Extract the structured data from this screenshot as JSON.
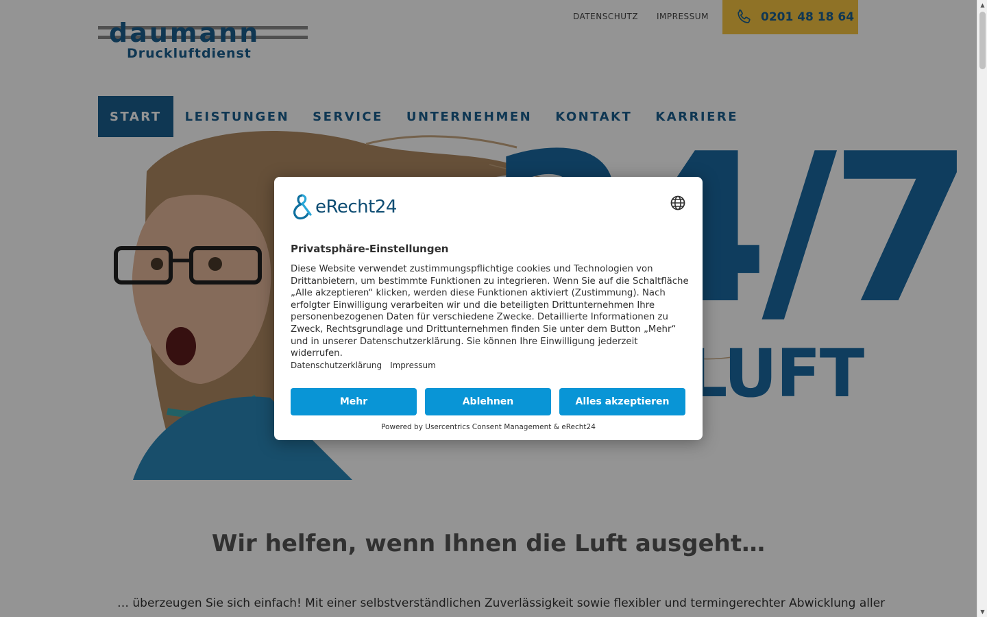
{
  "header": {
    "logo_main": "daumann",
    "logo_sub": "Druckluftdienst",
    "top_links": [
      "DATENSCHUTZ",
      "IMPRESSUM"
    ],
    "phone": "0201 48 18 64"
  },
  "nav": {
    "items": [
      "START",
      "LEISTUNGEN",
      "SERVICE",
      "UNTERNEHMEN",
      "KONTAKT",
      "KARRIERE"
    ],
    "active": "START"
  },
  "hero": {
    "big_text": "24/7",
    "sub_text": "DRUCKLUFT"
  },
  "intro": {
    "title": "Wir helfen, wenn Ihnen die Luft ausgeht…",
    "text": "… überzeugen Sie sich einfach! Mit einer selbstverständlichen Zuverlässigkeit sowie flexibler und termingerechter Abwicklung aller"
  },
  "consent": {
    "brand": "eRecht24",
    "title": "Privatsphäre-Einstellungen",
    "body": "Diese Website verwendet zustimmungspflichtige cookies und Technologien von Drittanbietern, um bestimmte Funktionen zu integrieren. Wenn Sie auf die Schaltfläche „Alle akzeptieren“ klicken, werden diese Funktionen aktiviert (Zustimmung). Nach erfolgter Einwilligung verarbeiten wir und die beteiligten Drittunternehmen Ihre personenbezogenen Daten für verschiedene Zwecke. Detaillierte Informationen zu Zweck, Rechtsgrundlage und Drittunternehmen finden Sie unter dem Button „Mehr“ und in unserer Datenschutzerklärung. Sie können Ihre Einwilligung jederzeit widerrufen.",
    "links": [
      "Datenschutzerklärung",
      "Impressum"
    ],
    "buttons": {
      "more": "Mehr",
      "deny": "Ablehnen",
      "accept_all": "Alles akzeptieren"
    },
    "powered_by": "Powered by Usercentrics Consent Management & eRecht24"
  },
  "colors": {
    "brand_blue": "#1b5f90",
    "phone_yellow": "#f6c443",
    "consent_button": "#0995d6"
  }
}
